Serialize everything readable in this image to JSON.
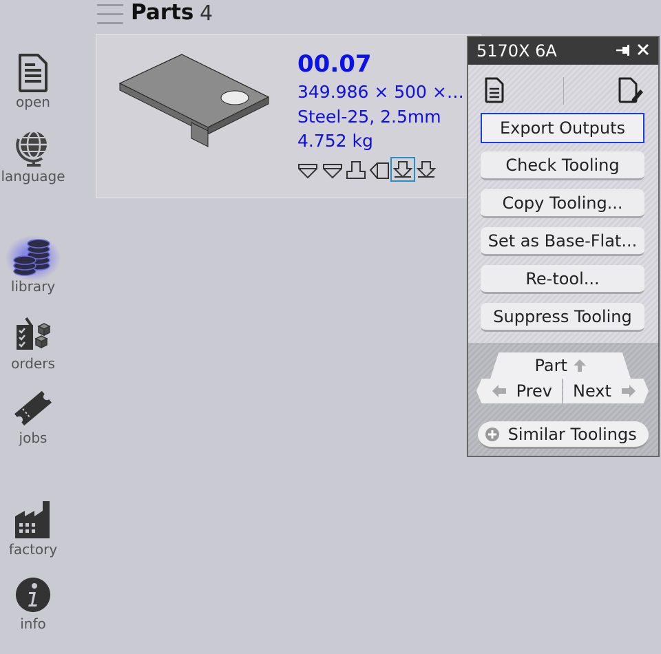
{
  "sidebar": {
    "items": [
      {
        "label": "open",
        "icon": "document-icon"
      },
      {
        "label": "language",
        "icon": "globe-icon"
      },
      {
        "label": "library",
        "icon": "coins-icon",
        "active": true
      },
      {
        "label": "orders",
        "icon": "orders-icon"
      },
      {
        "label": "jobs",
        "icon": "ticket-icon"
      },
      {
        "label": "factory",
        "icon": "factory-icon"
      },
      {
        "label": "info",
        "icon": "info-icon"
      }
    ]
  },
  "header": {
    "title": "Parts",
    "count": "4"
  },
  "part": {
    "name": "00.07",
    "dimensions": "349.986 × 500 ×…",
    "material": "Steel-25, 2.5mm",
    "weight": "4.752 kg",
    "tool_icons": [
      "bend-down-icon",
      "bend-down-icon",
      "bend-up-icon",
      "bend-left-icon",
      "bend-in-icon",
      "bend-in-icon"
    ],
    "selected_tool_index": 4
  },
  "panel": {
    "title": "5170X 6A",
    "buttons": [
      {
        "label": "Export Outputs"
      },
      {
        "label": "Check Tooling"
      },
      {
        "label": "Copy Tooling..."
      },
      {
        "label": "Set as Base-Flat..."
      },
      {
        "label": "Re-tool..."
      },
      {
        "label": "Suppress Tooling"
      }
    ],
    "nav": {
      "part": "Part",
      "prev": "Prev",
      "next": "Next"
    },
    "similar": "Similar Toolings"
  },
  "colors": {
    "background": "#cacad2",
    "accent_blue": "#0b12e8",
    "panel_header": "#3a3a3a",
    "focus_border": "#1a3ee0"
  }
}
